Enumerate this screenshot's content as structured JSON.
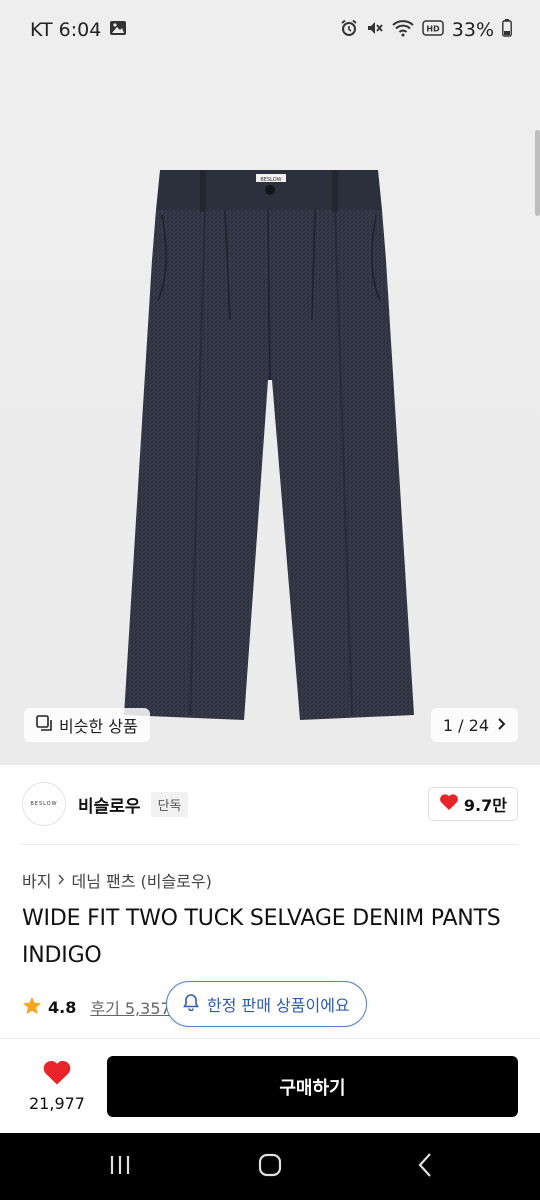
{
  "status_bar": {
    "carrier_time": "KT 6:04",
    "battery": "33%",
    "icons": [
      "gallery-icon",
      "alarm-icon",
      "mute-icon",
      "wifi-icon",
      "hd-icon",
      "battery-icon"
    ]
  },
  "gallery": {
    "similar_label": "비슷한 상품",
    "pager_text": "1 / 24",
    "image_tag": "BESLOW"
  },
  "brand": {
    "logo_text": "BESLOW",
    "name": "비슬로우",
    "badge": "단독",
    "likes": "9.7만"
  },
  "product": {
    "breadcrumb_category": "바지",
    "breadcrumb_sub": "데님 팬츠 (비슬로우)",
    "title": "WIDE FIT TWO TUCK SELVAGE DENIM PANTS INDIGO",
    "rating": "4.8",
    "reviews": "후기 5,357"
  },
  "toast": {
    "text": "한정 판매 상품이에요"
  },
  "purchase_bar": {
    "favorite_count": "21,977",
    "buy_label": "구매하기"
  },
  "colors": {
    "accent_blue": "#2f5bb0",
    "heart_red": "#e8232a",
    "star_orange": "#f5a623",
    "buy_bg": "#000000"
  }
}
